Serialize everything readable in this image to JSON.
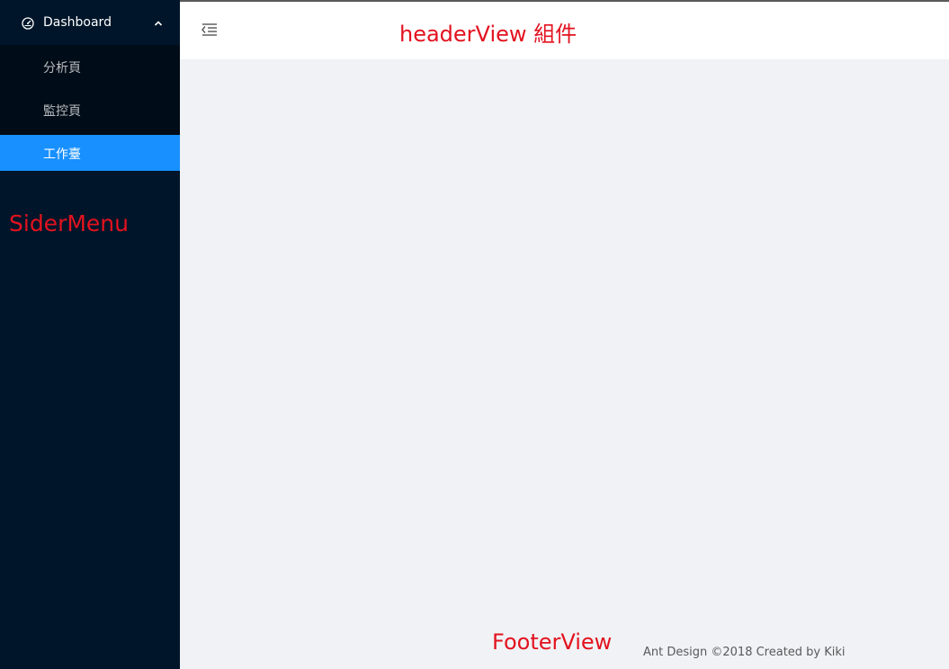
{
  "sider": {
    "submenu": {
      "title": "Dashboard",
      "icon": "dashboard-icon",
      "expanded": true
    },
    "items": [
      {
        "label": "分析頁",
        "active": false
      },
      {
        "label": "監控頁",
        "active": false
      },
      {
        "label": "工作臺",
        "active": true
      }
    ],
    "annotation": "SiderMenu"
  },
  "header": {
    "trigger_icon": "menu-fold-icon",
    "annotation": "headerView 組件"
  },
  "footer": {
    "annotation": "FooterView",
    "copyright": "Ant Design ©2018 Created by Kiki"
  },
  "colors": {
    "sider_bg": "#001529",
    "submenu_bg": "#000c17",
    "active_bg": "#1890ff",
    "content_bg": "#f0f2f5",
    "annotation": "#e3121f"
  }
}
